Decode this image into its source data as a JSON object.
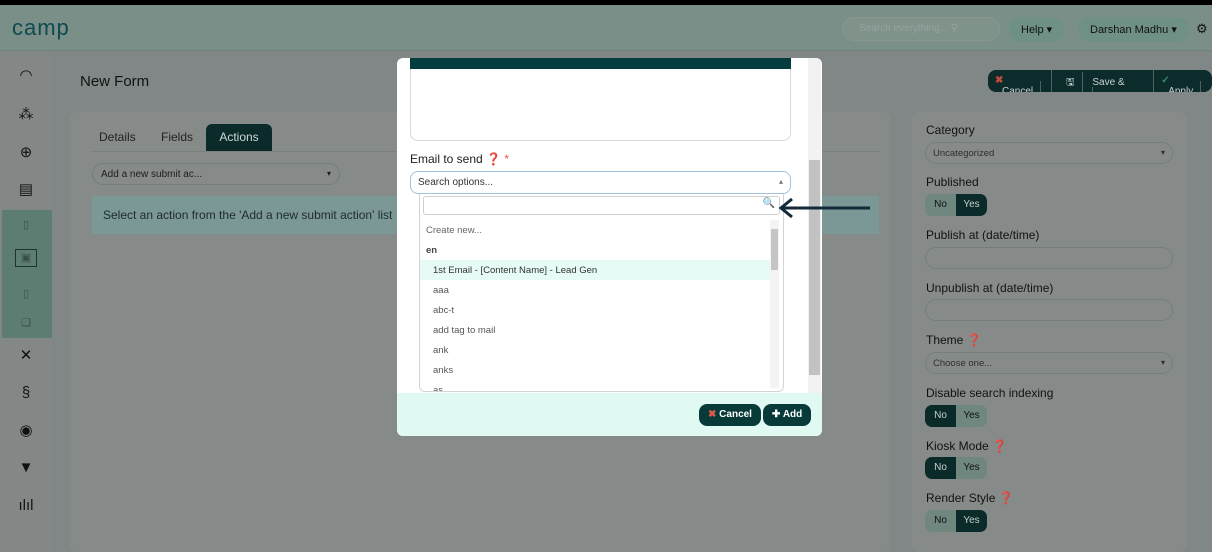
{
  "app": {
    "logo": "camp"
  },
  "header": {
    "search_placeholder": "Search everything...",
    "help": "Help",
    "user": "Darshan Madhu"
  },
  "page": {
    "title": "New Form",
    "cancel": "Cancel",
    "save_close": "Save & Close",
    "apply": "Apply"
  },
  "tabs": [
    {
      "label": "Details"
    },
    {
      "label": "Fields"
    },
    {
      "label": "Actions",
      "active": true
    }
  ],
  "main": {
    "submit_action_placeholder": "Add a new submit ac...",
    "info": "Select an action from the 'Add a new submit action' list"
  },
  "panel": {
    "category_label": "Category",
    "category_value": "Uncategorized",
    "published_label": "Published",
    "published": "Yes",
    "publish_at_label": "Publish at (date/time)",
    "unpublish_at_label": "Unpublish at (date/time)",
    "theme_label": "Theme",
    "theme_value": "Choose one...",
    "search_index_label": "Disable search indexing",
    "search_index": "No",
    "kiosk_label": "Kiosk Mode",
    "kiosk": "No",
    "render_label": "Render Style",
    "render": "Yes",
    "no": "No",
    "yes": "Yes"
  },
  "modal": {
    "email_label": "Email to send",
    "required": "*",
    "select_placeholder": "Search options...",
    "create_new": "Create new...",
    "group": "en",
    "options": [
      "1st Email - [Content Name] - Lead Gen",
      "aaa",
      "abc-t",
      "add tag to mail",
      "ank",
      "anks",
      "as"
    ],
    "cancel": "Cancel",
    "add": "Add"
  },
  "colors": {
    "accent": "#083a3a",
    "footer": "#e0faf3",
    "highlight": "#e6fbf5"
  }
}
